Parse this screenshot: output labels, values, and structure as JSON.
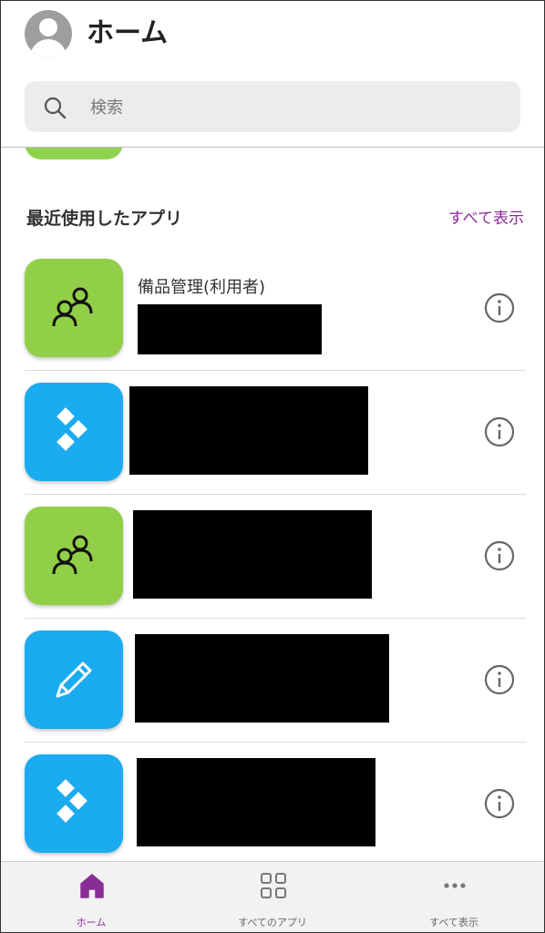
{
  "header": {
    "title": "ホーム",
    "search_placeholder": "検索"
  },
  "recent": {
    "section_title": "最近使用したアプリ",
    "see_all": "すべて表示",
    "items": [
      {
        "name": "備品管理(利用者)",
        "tile_color": "#92cf48",
        "icon": "people-icon"
      },
      {
        "name": "",
        "tile_color": "#1aabf0",
        "icon": "blocks-icon"
      },
      {
        "name": "",
        "tile_color": "#92cf48",
        "icon": "people-icon"
      },
      {
        "name": "",
        "tile_color": "#1aabf0",
        "icon": "pencil-icon"
      },
      {
        "name": "",
        "tile_color": "#1aabf0",
        "icon": "blocks-icon"
      }
    ]
  },
  "nav": {
    "items": [
      {
        "label": "ホーム",
        "icon": "home-icon",
        "active": true
      },
      {
        "label": "すべてのアプリ",
        "icon": "grid-icon",
        "active": false
      },
      {
        "label": "すべて表示",
        "icon": "more-icon",
        "active": false
      }
    ]
  },
  "colors": {
    "accent": "#8a2c96",
    "green_tile": "#92cf48",
    "blue_tile": "#1aabf0"
  }
}
